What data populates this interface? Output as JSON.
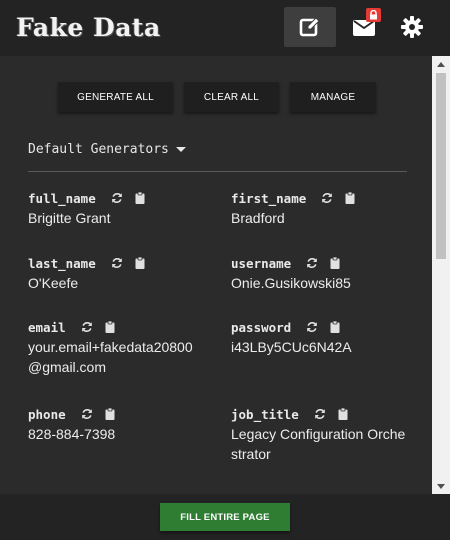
{
  "app": {
    "logo_text": "Fake Data"
  },
  "header": {
    "edit_icon": "edit-icon",
    "mail_icon": "mail-lock-icon",
    "settings_icon": "gear-icon"
  },
  "toolbar": {
    "generate_all": "GENERATE ALL",
    "clear_all": "CLEAR ALL",
    "manage": "MANAGE"
  },
  "generator_select": {
    "selected": "Default Generators"
  },
  "fields": [
    {
      "name": "full_name",
      "value": "Brigitte Grant"
    },
    {
      "name": "first_name",
      "value": "Bradford"
    },
    {
      "name": "last_name",
      "value": "O'Keefe"
    },
    {
      "name": "username",
      "value": "Onie.Gusikowski85"
    },
    {
      "name": "email",
      "value": "your.email+fakedata20800@gmail.com"
    },
    {
      "name": "password",
      "value": "i43LBy5CUc6N42A"
    },
    {
      "name": "phone",
      "value": "828-884-7398"
    },
    {
      "name": "job_title",
      "value": "Legacy Configuration Orchestrator"
    }
  ],
  "footer": {
    "fill_entire_page": "FILL ENTIRE PAGE"
  },
  "colors": {
    "background": "#2b2b2b",
    "header": "#232323",
    "button": "#1f1f1f",
    "fill_button": "#2e7d32",
    "badge": "#e53935"
  }
}
